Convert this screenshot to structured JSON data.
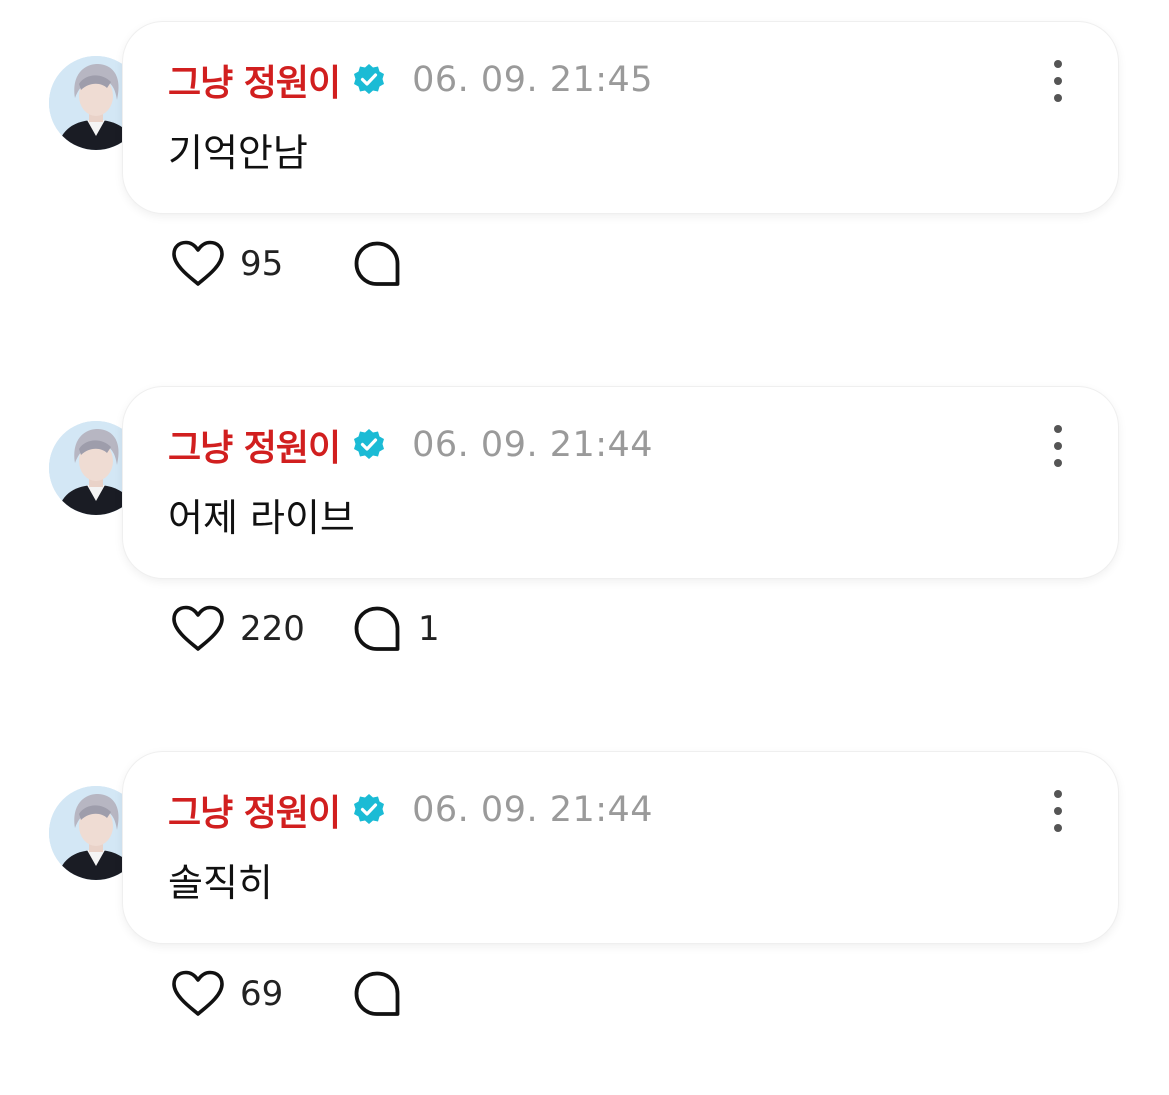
{
  "accent_color": "#d11f1f",
  "verified_color": "#1bbbd5",
  "posts": [
    {
      "author": "그냥 정원이",
      "timestamp": "06. 09. 21:45",
      "text": "기억안남",
      "likes": "95",
      "replies": ""
    },
    {
      "author": "그냥 정원이",
      "timestamp": "06. 09. 21:44",
      "text": "어제 라이브",
      "likes": "220",
      "replies": "1"
    },
    {
      "author": "그냥 정원이",
      "timestamp": "06. 09. 21:44",
      "text": "솔직히",
      "likes": "69",
      "replies": ""
    }
  ],
  "icons": {
    "avatar": "profile-photo",
    "verified": "verified-badge-icon",
    "more": "more-vertical-icon",
    "like": "heart-outline-icon",
    "reply": "speech-bubble-icon"
  }
}
